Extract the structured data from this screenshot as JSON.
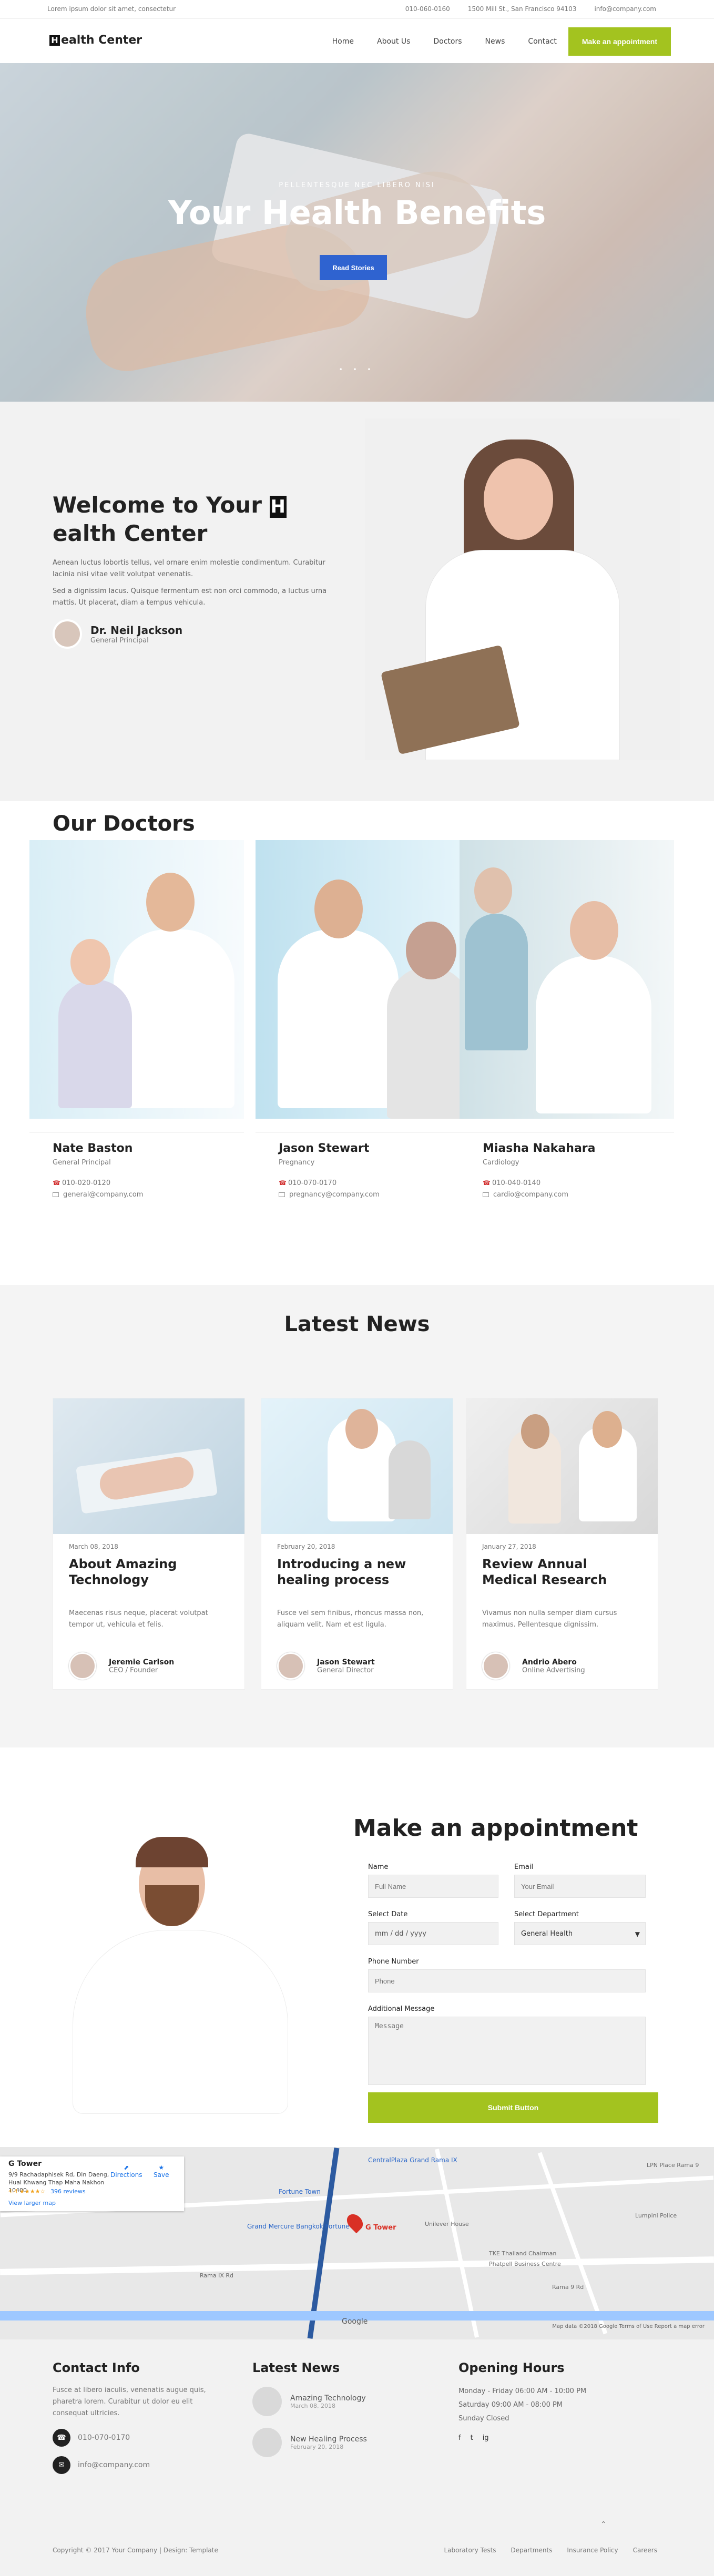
{
  "top_bar": {
    "left": "Lorem ipsum dolor sit amet, consectetur",
    "phone": "010-060-0160",
    "address": "1500 Mill St., San Francisco 94103",
    "email": "info@company.com"
  },
  "header": {
    "logo_text": "ealth Center",
    "logo_initial": "H",
    "nav": [
      "Home",
      "About Us",
      "Doctors",
      "News",
      "Contact"
    ],
    "appointment_button": "Make an appointment"
  },
  "hero": {
    "subtitle": "PELLENTESQUE NEC LIBERO NISI",
    "title": "Your Health Benefits",
    "button": "Read Stories",
    "dots": "• • •"
  },
  "welcome": {
    "title_before": "Welcome to Your ",
    "title_h": "H",
    "title_after": "ealth Center",
    "paragraph1": "Aenean luctus lobortis tellus, vel ornare enim molestie condimentum. Curabitur lacinia nisi vitae velit volutpat venenatis.",
    "paragraph2": "Sed a dignissim lacus. Quisque fermentum est non orci commodo, a luctus urna mattis. Ut placerat, diam a tempus vehicula.",
    "principal_name": "Dr. Neil Jackson",
    "principal_role": "General Principal"
  },
  "doctors": {
    "title": "Our Doctors",
    "items": [
      {
        "name": "Nate Baston",
        "role": "General Principal",
        "phone": "010-020-0120",
        "email": "general@company.com"
      },
      {
        "name": "Jason Stewart",
        "role": "Pregnancy",
        "phone": "010-070-0170",
        "email": "pregnancy@company.com"
      },
      {
        "name": "Miasha Nakahara",
        "role": "Cardiology",
        "phone": "010-040-0140",
        "email": "cardio@company.com"
      }
    ]
  },
  "news": {
    "title": "Latest News",
    "items": [
      {
        "date": "March 08, 2018",
        "title": "About Amazing Technology",
        "text": "Maecenas risus neque, placerat volutpat tempor ut, vehicula et felis.",
        "author": "Jeremie Carlson",
        "author_role": "CEO / Founder"
      },
      {
        "date": "February 20, 2018",
        "title": "Introducing a new healing process",
        "text": "Fusce vel sem finibus, rhoncus massa non, aliquam velit. Nam et est ligula.",
        "author": "Jason Stewart",
        "author_role": "General Director"
      },
      {
        "date": "January 27, 2018",
        "title": "Review Annual Medical Research",
        "text": "Vivamus non nulla semper diam cursus maximus. Pellentesque dignissim.",
        "author": "Andrio Abero",
        "author_role": "Online Advertising"
      }
    ]
  },
  "appointment": {
    "title": "Make an appointment",
    "name_label": "Name",
    "email_label": "Email",
    "name_placeholder": "Full Name",
    "email_placeholder": "Your Email",
    "date_label": "Select Date",
    "date_value": "mm / dd / yyyy",
    "department_label": "Select Department",
    "department_value": "General Health",
    "phone_label": "Phone Number",
    "phone_placeholder": "Phone",
    "message_label": "Additional Message",
    "message_placeholder": "Message",
    "submit": "Submit Button"
  },
  "map": {
    "place": "G Tower",
    "address": "9/9 Rachadaphisek Rd, Din Daeng, Huai Khwang Thap Maha Nakhon 10400",
    "rating": "4.4 ★★★★☆",
    "reviews": "396 reviews",
    "larger_map": "View larger map",
    "directions": "Directions",
    "save": "Save",
    "pin_label": "G Tower",
    "labels": [
      "CentralPlaza Grand Rama IX",
      "Fortune Town",
      "Grand Mercure Bangkok Fortune",
      "Unilever House",
      "TKE Thailand Chairman",
      "Phatpell Business Centre",
      "Rama IX Rd",
      "Rama 9 Rd",
      "Lumpini Police",
      "LPN Place Rama 9"
    ],
    "google": "Google",
    "footer_note": "Map data ©2018 Google   Terms of Use   Report a map error"
  },
  "footer": {
    "contact_title": "Contact Info",
    "contact_text": "Fusce at libero iaculis, venenatis augue quis, pharetra lorem. Curabitur ut dolor eu elit consequat ultricies.",
    "contact_phone": "010-070-0170",
    "contact_email": "info@company.com",
    "news_title": "Latest News",
    "news_items": [
      {
        "title": "Amazing Technology",
        "date": "March 08, 2018"
      },
      {
        "title": "New Healing Process",
        "date": "February 20, 2018"
      }
    ],
    "hours_title": "Opening Hours",
    "hours": [
      "Monday - Friday   06:00 AM - 10:00 PM",
      "Saturday   09:00 AM - 08:00 PM",
      "Sunday   Closed"
    ],
    "social": [
      "f",
      "t",
      "ig"
    ],
    "copyright": "Copyright © 2017 Your Company | Design: Template",
    "links": [
      "Laboratory Tests",
      "Departments",
      "Insurance Policy",
      "Careers"
    ]
  }
}
